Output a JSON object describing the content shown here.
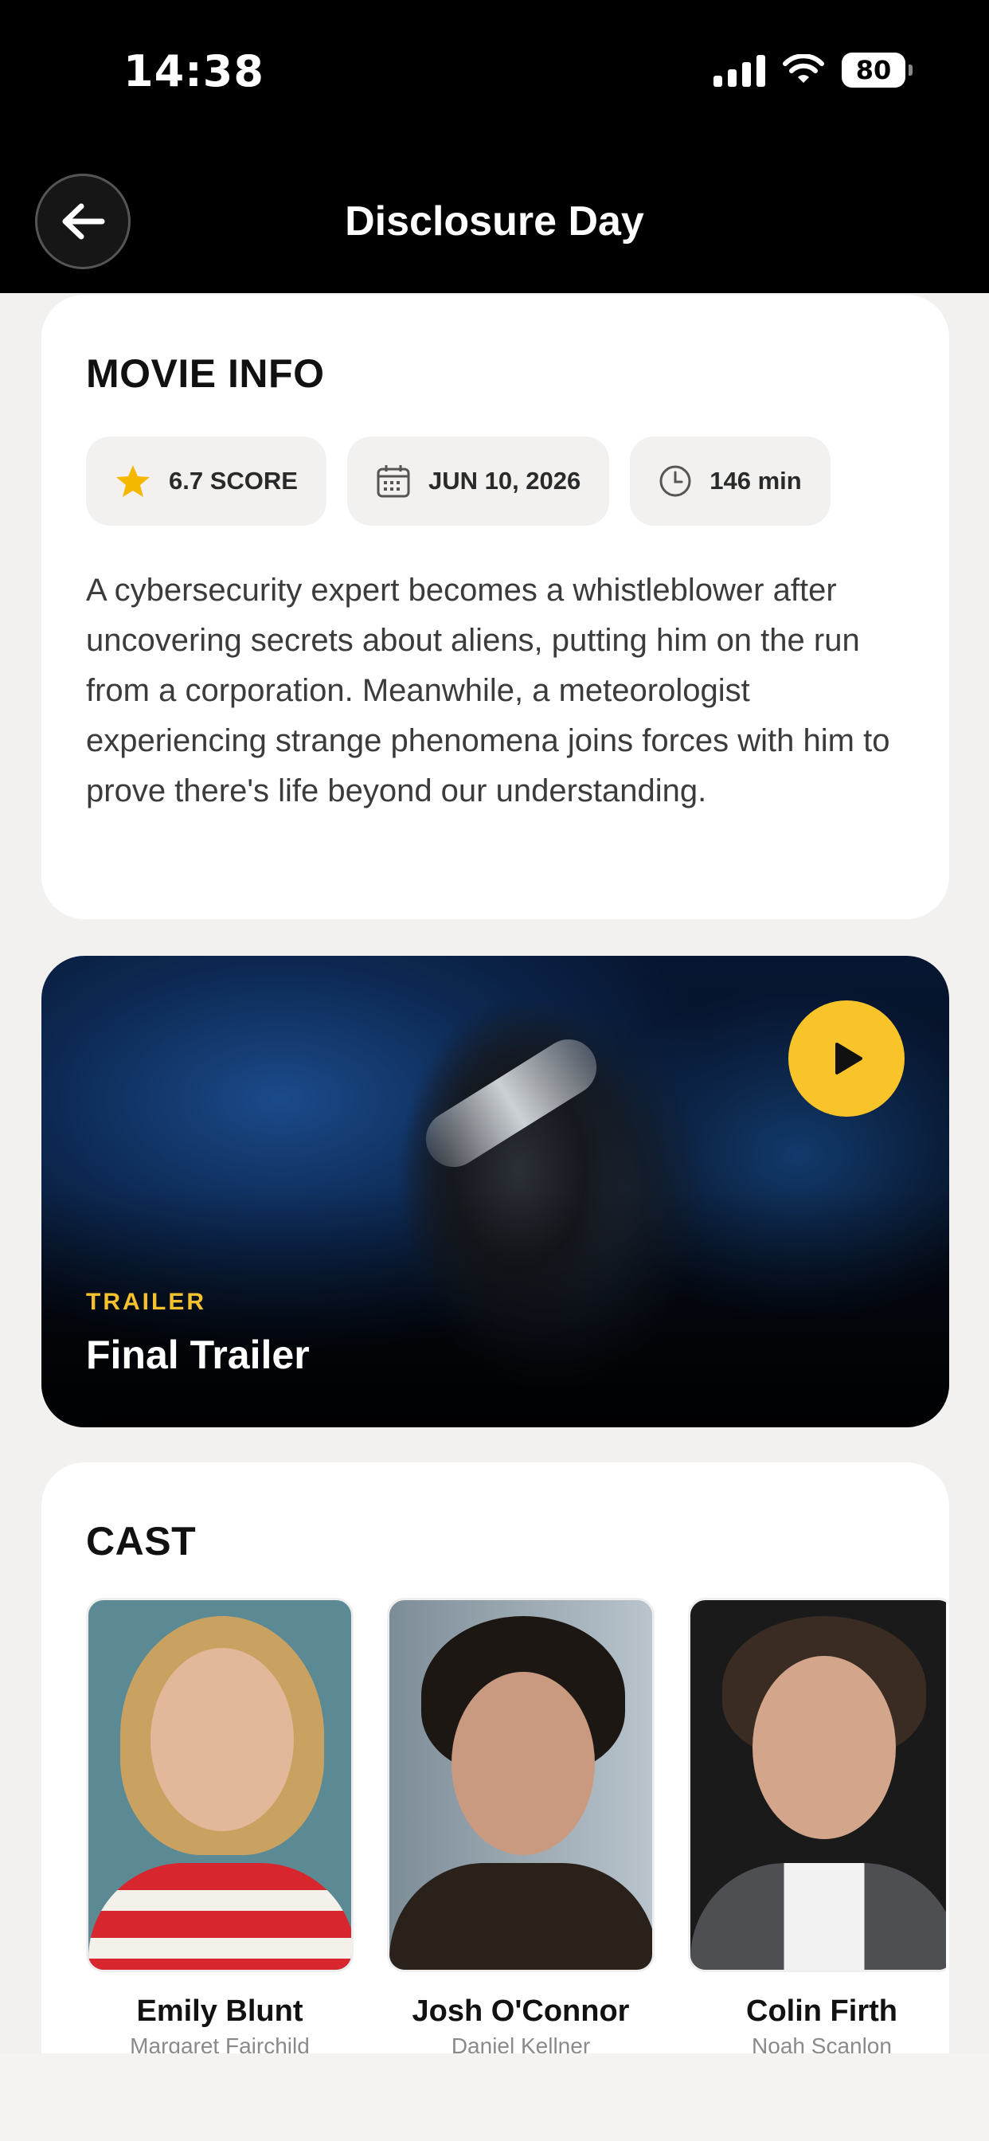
{
  "status_bar": {
    "time": "14:38",
    "battery": "80"
  },
  "header": {
    "title": "Disclosure Day",
    "back_icon": "arrow-left-icon"
  },
  "movie_info": {
    "title": "MOVIE INFO",
    "score": "6.7 SCORE",
    "release_date": "JUN 10, 2026",
    "runtime": "146 min",
    "description": "A cybersecurity expert becomes a whistleblower after uncovering secrets about aliens, putting him on the run from a corporation. Meanwhile, a meteorologist experiencing strange phenomena joins forces with him to prove there's life beyond our understanding.",
    "accent_color": "#f5b800"
  },
  "trailer": {
    "kicker": "TRAILER",
    "title": "Final Trailer",
    "play_color": "#f8c42a"
  },
  "cast": {
    "title": "CAST",
    "members": [
      {
        "name": "Emily Blunt",
        "role": "Margaret Fairchild"
      },
      {
        "name": "Josh O'Connor",
        "role": "Daniel Kellner"
      },
      {
        "name": "Colin Firth",
        "role": "Noah Scanlon"
      }
    ]
  }
}
